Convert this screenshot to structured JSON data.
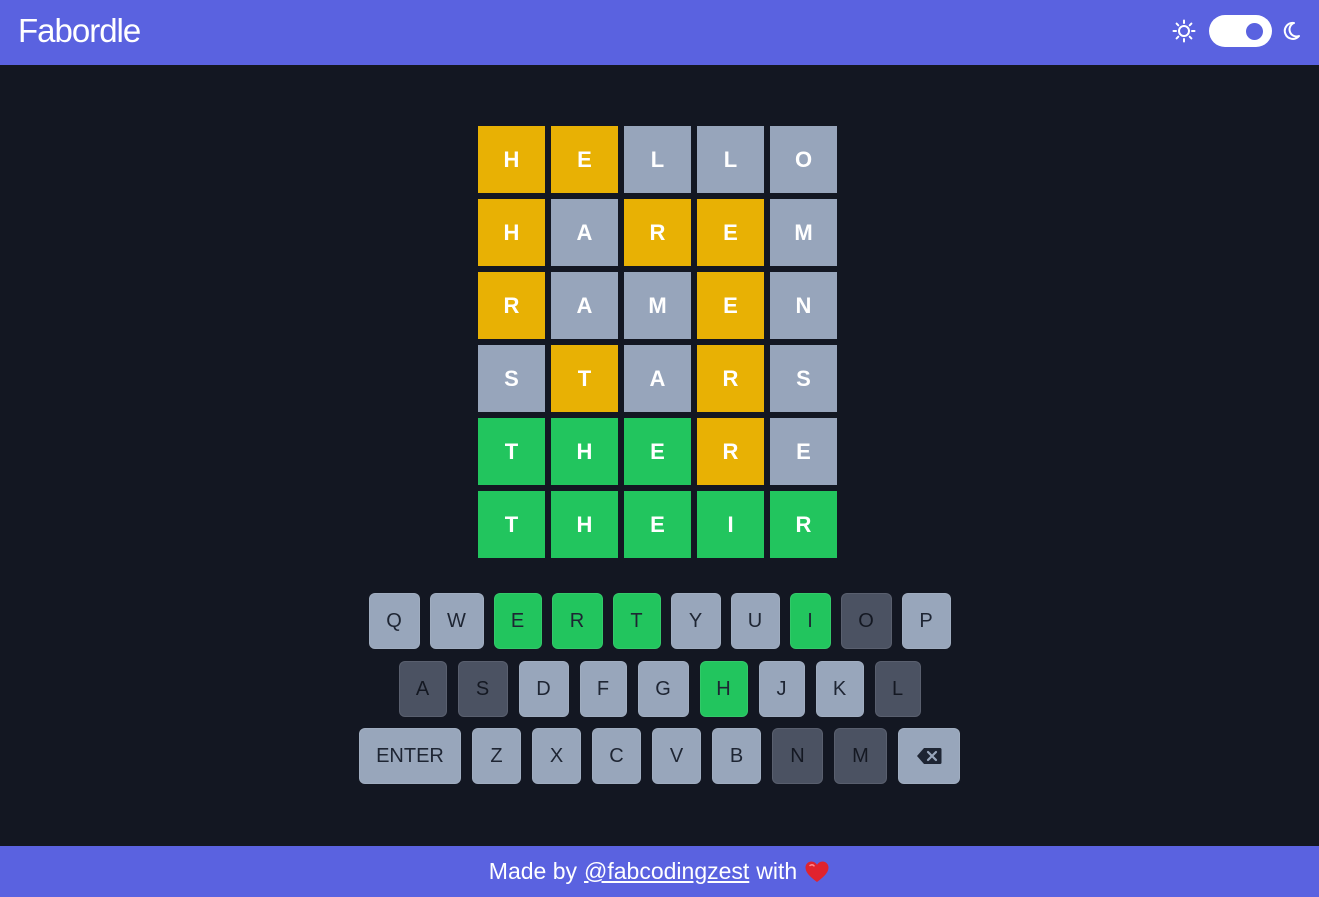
{
  "header": {
    "title": "Fabordle",
    "sun_icon": "sun-icon",
    "moon_icon": "moon-icon",
    "theme_toggle_state": "dark",
    "colors": {
      "bar": "#5a62e0"
    }
  },
  "colors": {
    "background": "#131722",
    "absent": "#97a5bb",
    "present": "#e8b104",
    "correct": "#22c55e",
    "key_absent": "#4b5262"
  },
  "board": {
    "rows": [
      [
        {
          "l": "H",
          "s": "present"
        },
        {
          "l": "E",
          "s": "present"
        },
        {
          "l": "L",
          "s": "absent"
        },
        {
          "l": "L",
          "s": "absent"
        },
        {
          "l": "O",
          "s": "absent"
        }
      ],
      [
        {
          "l": "H",
          "s": "present"
        },
        {
          "l": "A",
          "s": "absent"
        },
        {
          "l": "R",
          "s": "present"
        },
        {
          "l": "E",
          "s": "present"
        },
        {
          "l": "M",
          "s": "absent"
        }
      ],
      [
        {
          "l": "R",
          "s": "present"
        },
        {
          "l": "A",
          "s": "absent"
        },
        {
          "l": "M",
          "s": "absent"
        },
        {
          "l": "E",
          "s": "present"
        },
        {
          "l": "N",
          "s": "absent"
        }
      ],
      [
        {
          "l": "S",
          "s": "absent"
        },
        {
          "l": "T",
          "s": "present"
        },
        {
          "l": "A",
          "s": "absent"
        },
        {
          "l": "R",
          "s": "present"
        },
        {
          "l": "S",
          "s": "absent"
        }
      ],
      [
        {
          "l": "T",
          "s": "correct"
        },
        {
          "l": "H",
          "s": "correct"
        },
        {
          "l": "E",
          "s": "correct"
        },
        {
          "l": "R",
          "s": "present"
        },
        {
          "l": "E",
          "s": "absent"
        }
      ],
      [
        {
          "l": "T",
          "s": "correct"
        },
        {
          "l": "H",
          "s": "correct"
        },
        {
          "l": "E",
          "s": "correct"
        },
        {
          "l": "I",
          "s": "correct"
        },
        {
          "l": "R",
          "s": "correct"
        }
      ]
    ]
  },
  "keyboard": {
    "rows": [
      [
        {
          "label": "Q",
          "state": "unused"
        },
        {
          "label": "W",
          "state": "unused"
        },
        {
          "label": "E",
          "state": "correct"
        },
        {
          "label": "R",
          "state": "correct"
        },
        {
          "label": "T",
          "state": "correct"
        },
        {
          "label": "Y",
          "state": "unused"
        },
        {
          "label": "U",
          "state": "unused"
        },
        {
          "label": "I",
          "state": "correct"
        },
        {
          "label": "O",
          "state": "absent"
        },
        {
          "label": "P",
          "state": "unused"
        }
      ],
      [
        {
          "label": "A",
          "state": "absent"
        },
        {
          "label": "S",
          "state": "absent"
        },
        {
          "label": "D",
          "state": "unused"
        },
        {
          "label": "F",
          "state": "unused"
        },
        {
          "label": "G",
          "state": "unused"
        },
        {
          "label": "H",
          "state": "correct"
        },
        {
          "label": "J",
          "state": "unused"
        },
        {
          "label": "K",
          "state": "unused"
        },
        {
          "label": "L",
          "state": "absent"
        }
      ],
      [
        {
          "label": "ENTER",
          "state": "unused",
          "wide": true
        },
        {
          "label": "Z",
          "state": "unused"
        },
        {
          "label": "X",
          "state": "unused"
        },
        {
          "label": "C",
          "state": "unused"
        },
        {
          "label": "V",
          "state": "unused"
        },
        {
          "label": "B",
          "state": "unused"
        },
        {
          "label": "N",
          "state": "absent"
        },
        {
          "label": "M",
          "state": "absent"
        },
        {
          "label": "",
          "state": "unused",
          "icon": "backspace-icon",
          "wide": true
        }
      ]
    ]
  },
  "footer": {
    "prefix": "Made by",
    "link_text": "@fabcodingzest",
    "suffix": "with",
    "heart_icon": "heart-icon"
  }
}
